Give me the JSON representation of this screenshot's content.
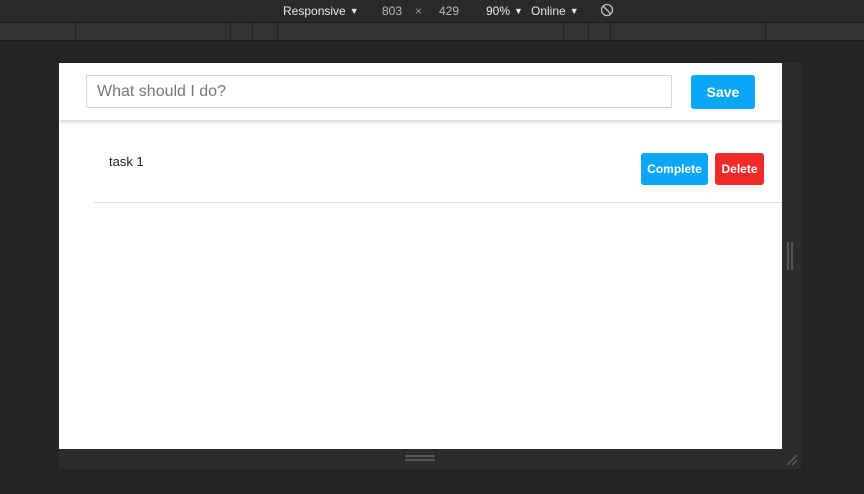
{
  "devtools": {
    "device": "Responsive",
    "width": "803",
    "separator": "×",
    "height": "429",
    "zoom": "90%",
    "throttle": "Online"
  },
  "app": {
    "input": {
      "placeholder": "What should I do?",
      "value": ""
    },
    "save_label": "Save",
    "tasks": [
      {
        "text": "task 1",
        "complete_label": "Complete",
        "delete_label": "Delete"
      }
    ]
  },
  "colors": {
    "primary": "#0aa6f7",
    "danger": "#f02a2a"
  }
}
